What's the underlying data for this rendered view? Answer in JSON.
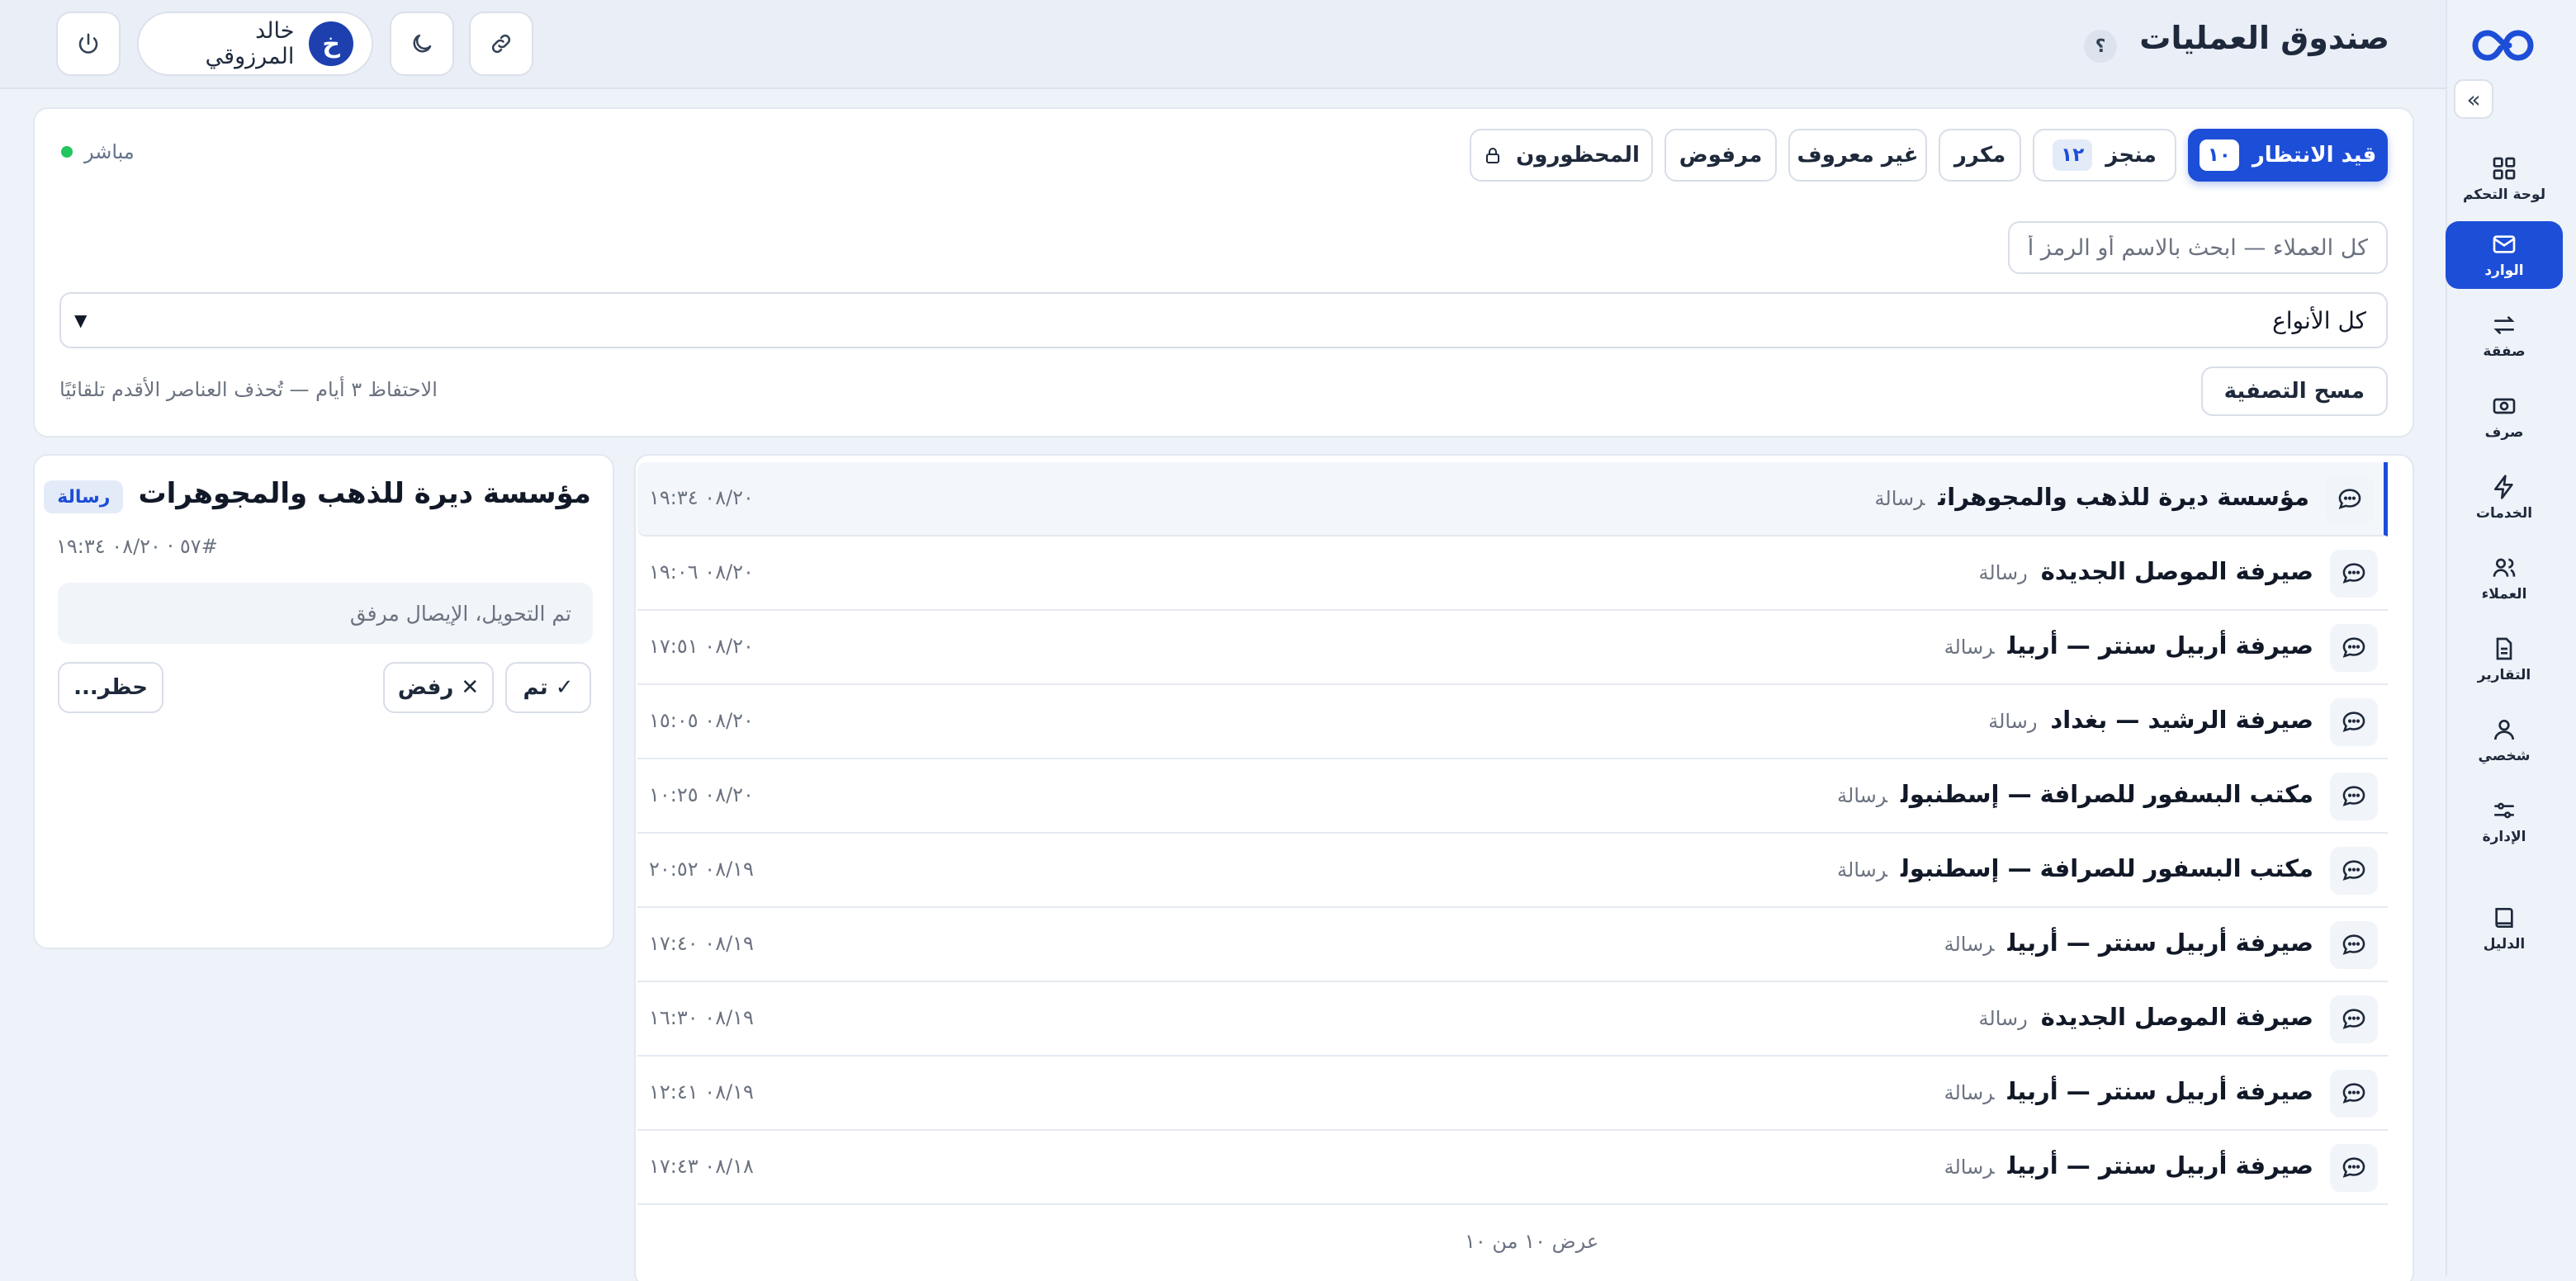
{
  "header": {
    "title": "صندوق العمليات",
    "help_label": "؟",
    "user": {
      "initial": "خ",
      "name": "خالد المرزوقي"
    }
  },
  "sidebar": {
    "items": [
      {
        "label": "لوحة التحكم",
        "icon": "dashboard-icon"
      },
      {
        "label": "الوارد",
        "icon": "inbox-icon",
        "active": true
      },
      {
        "label": "صفقة",
        "icon": "exchange-icon"
      },
      {
        "label": "صرف",
        "icon": "cash-icon"
      },
      {
        "label": "الخدمات",
        "icon": "bolt-icon"
      },
      {
        "label": "العملاء",
        "icon": "users-icon"
      },
      {
        "label": "التقارير",
        "icon": "report-icon"
      },
      {
        "label": "شخصي",
        "icon": "user-icon"
      },
      {
        "label": "الإدارة",
        "icon": "sliders-icon"
      },
      {
        "label": "الدليل",
        "icon": "book-icon"
      }
    ]
  },
  "filters": {
    "tabs": [
      {
        "label": "قيد الانتظار",
        "count": "١٠",
        "active": true
      },
      {
        "label": "منجز",
        "count": "١٢"
      },
      {
        "label": "مكرر"
      },
      {
        "label": "غير معروف"
      },
      {
        "label": "مرفوض"
      },
      {
        "label": "المحظورون",
        "icon": "lock-icon"
      }
    ],
    "live_label": "مباشر",
    "search_placeholder": "كل العملاء — ابحث بالاسم أو الرمز أو",
    "type_select": "كل الأنواع",
    "clear_label": "مسح التصفية",
    "retention_note": "الاحتفاظ ٣ أيام — تُحذف العناصر الأقدم تلقائيًا"
  },
  "list": {
    "rows": [
      {
        "name": "مؤسسة ديرة للذهب والمجوهرات",
        "type": "رسالة",
        "time": "٠٨/٢٠ ١٩:٣٤",
        "selected": true
      },
      {
        "name": "صيرفة الموصل الجديدة",
        "type": "رسالة",
        "time": "٠٨/٢٠ ١٩:٠٦"
      },
      {
        "name": "صيرفة أربيل سنتر — أربيل",
        "type": "رسالة",
        "time": "٠٨/٢٠ ١٧:٥١"
      },
      {
        "name": "صيرفة الرشيد — بغداد",
        "type": "رسالة",
        "time": "٠٨/٢٠ ١٥:٠٥"
      },
      {
        "name": "مكتب البسفور للصرافة — إسطنبول",
        "type": "رسالة",
        "time": "٠٨/٢٠ ١٠:٢٥"
      },
      {
        "name": "مكتب البسفور للصرافة — إسطنبول",
        "type": "رسالة",
        "time": "٠٨/١٩ ٢٠:٥٢"
      },
      {
        "name": "صيرفة أربيل سنتر — أربيل",
        "type": "رسالة",
        "time": "٠٨/١٩ ١٧:٤٠"
      },
      {
        "name": "صيرفة الموصل الجديدة",
        "type": "رسالة",
        "time": "٠٨/١٩ ١٦:٣٠"
      },
      {
        "name": "صيرفة أربيل سنتر — أربيل",
        "type": "رسالة",
        "time": "٠٨/١٩ ١٢:٤١"
      },
      {
        "name": "صيرفة أربيل سنتر — أربيل",
        "type": "رسالة",
        "time": "٠٨/١٨ ١٧:٤٣"
      }
    ],
    "footer": "عرض ١٠ من ١٠"
  },
  "detail": {
    "title": "مؤسسة ديرة للذهب والمجوهرات",
    "badge": "رسالة",
    "meta": "#٥٧ · ٠٨/٢٠ ١٩:٣٤",
    "note_placeholder": "تم التحويل، الإيصال مرفق",
    "done_label": "✓ تم",
    "reject_label": "✕ رفض",
    "block_label": "حظر..."
  },
  "colors": {
    "accent": "#1d4ed8",
    "live": "#22c55e",
    "background": "#eef2f9"
  }
}
